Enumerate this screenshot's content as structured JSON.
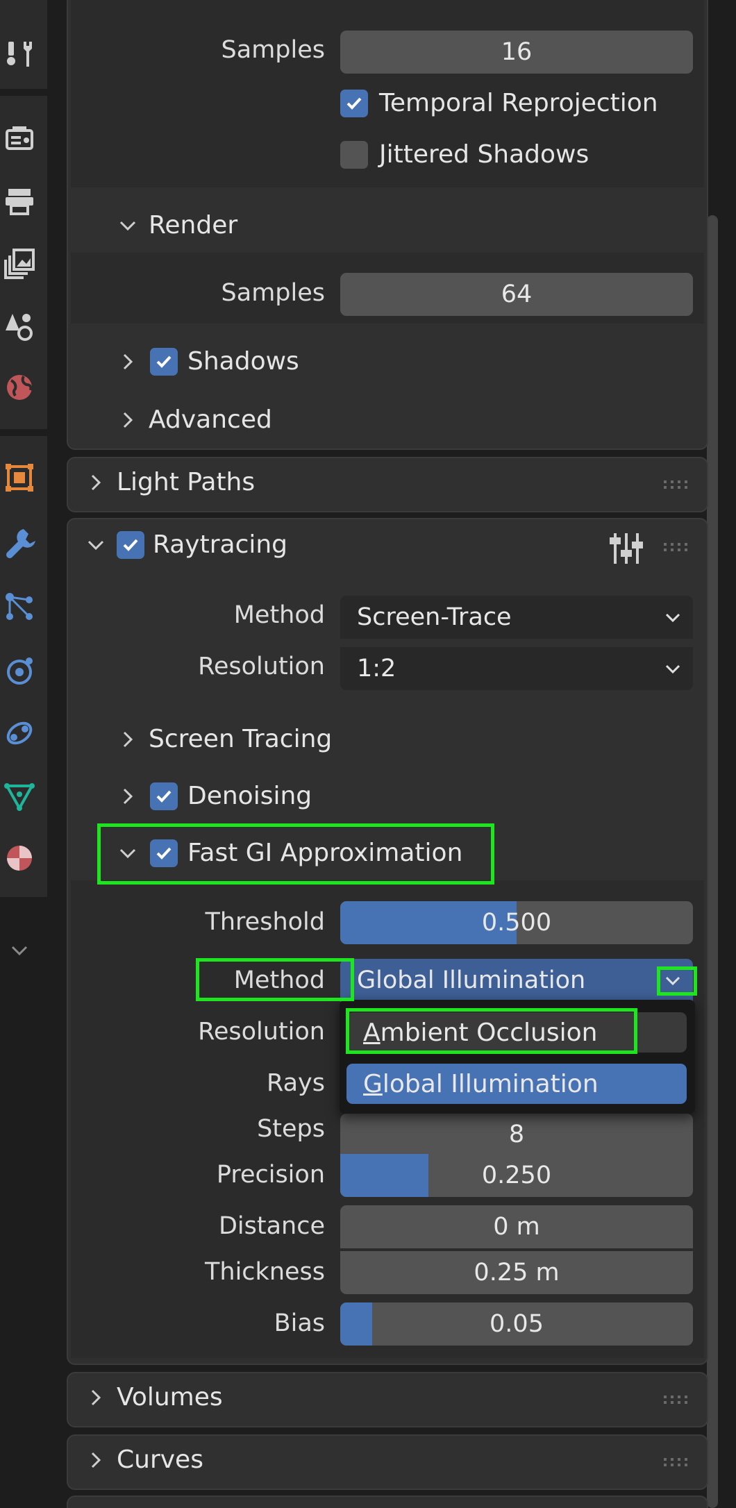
{
  "colors": {
    "accent": "#4772b3",
    "highlight": "#1ee61e",
    "panel": "#303030",
    "field": "#545454"
  },
  "tabs": [
    {
      "icon": "tool-icon"
    },
    {
      "icon": "render-icon"
    },
    {
      "icon": "output-icon"
    },
    {
      "icon": "view-layer-icon"
    },
    {
      "icon": "scene-icon"
    },
    {
      "icon": "world-icon"
    },
    {
      "icon": "object-icon"
    },
    {
      "icon": "modifier-icon"
    },
    {
      "icon": "particles-icon"
    },
    {
      "icon": "physics-icon"
    },
    {
      "icon": "constraints-icon"
    },
    {
      "icon": "data-icon"
    },
    {
      "icon": "material-icon"
    },
    {
      "icon": "expand-icon"
    }
  ],
  "viewport": {
    "samples_label": "Samples",
    "samples_value": "16",
    "temporal_reprojection": {
      "label": "Temporal Reprojection",
      "checked": true
    },
    "jittered_shadows": {
      "label": "Jittered Shadows",
      "checked": false
    }
  },
  "render": {
    "title": "Render",
    "samples_label": "Samples",
    "samples_value": "64"
  },
  "shadows": {
    "title": "Shadows",
    "checked": true
  },
  "advanced": {
    "title": "Advanced"
  },
  "light_paths": {
    "title": "Light Paths"
  },
  "raytracing": {
    "title": "Raytracing",
    "checked": true,
    "method_label": "Method",
    "method_value": "Screen-Trace",
    "resolution_label": "Resolution",
    "resolution_value": "1:2",
    "screen_tracing": {
      "title": "Screen Tracing"
    },
    "denoising": {
      "title": "Denoising",
      "checked": true
    }
  },
  "fast_gi": {
    "title": "Fast GI Approximation",
    "checked": true,
    "threshold_label": "Threshold",
    "threshold_value": "0.500",
    "threshold_fraction": 0.5,
    "method_label": "Method",
    "method_value": "Global Illumination",
    "resolution_label": "Resolution",
    "rays_label": "Rays",
    "steps_label": "Steps",
    "steps_value": "8",
    "precision_label": "Precision",
    "precision_value": "0.250",
    "precision_fraction": 0.25,
    "distance_label": "Distance",
    "distance_value": "0 m",
    "thickness_label": "Thickness",
    "thickness_value": "0.25 m",
    "bias_label": "Bias",
    "bias_value": "0.05",
    "bias_fraction": 0.05
  },
  "method_dropdown": {
    "options": [
      {
        "first": "A",
        "rest": "mbient Occlusion",
        "selected": false
      },
      {
        "first": "G",
        "rest": "lobal Illumination",
        "selected": true
      }
    ]
  },
  "volumes": {
    "title": "Volumes"
  },
  "curves": {
    "title": "Curves"
  }
}
